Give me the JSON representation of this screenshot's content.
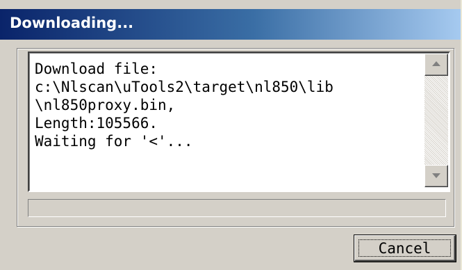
{
  "window": {
    "title": "Downloading..."
  },
  "log": {
    "text": "Download file:\nc:\\Nlscan\\uTools2\\target\\nl850\\lib\n\\nl850proxy.bin,\nLength:105566.\nWaiting for '<'..."
  },
  "scrollbar": {
    "up_icon": "scroll-up-arrow-icon",
    "down_icon": "scroll-down-arrow-icon"
  },
  "progress": {
    "fraction": 0
  },
  "buttons": {
    "cancel_label": "Cancel"
  },
  "colors": {
    "title_gradient_start": "#0a246a",
    "title_gradient_end": "#a6caf0",
    "dialog_face": "#d4d0c8"
  }
}
